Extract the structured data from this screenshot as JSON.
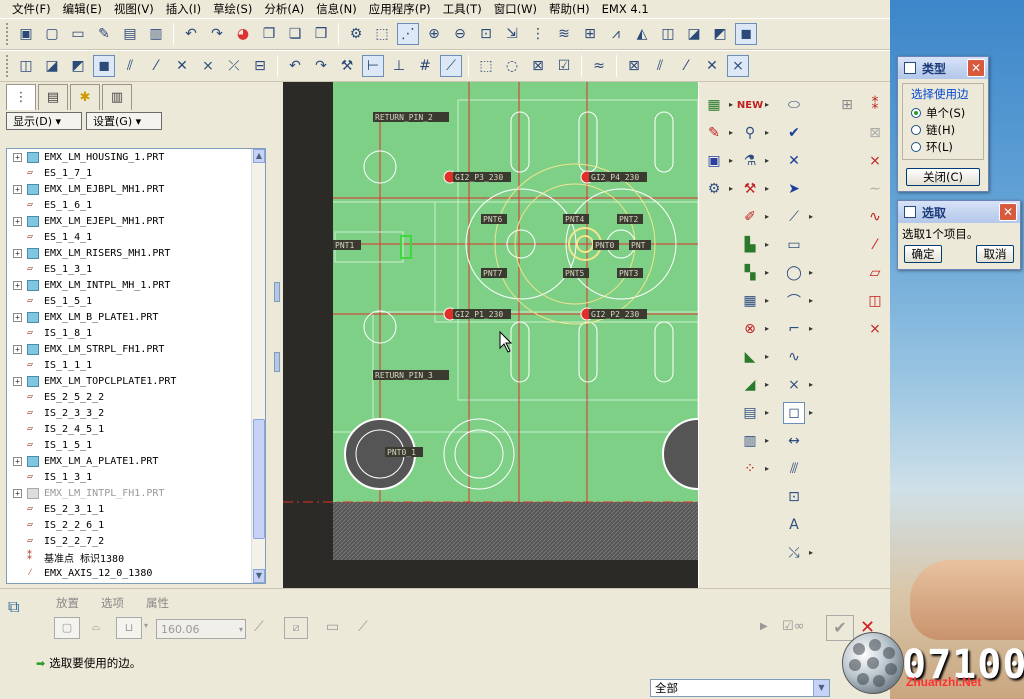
{
  "menu": [
    "文件(F)",
    "编辑(E)",
    "视图(V)",
    "插入(I)",
    "草绘(S)",
    "分析(A)",
    "信息(N)",
    "应用程序(P)",
    "工具(T)",
    "窗口(W)",
    "帮助(H)",
    "EMX 4.1"
  ],
  "panel": {
    "show_label": "显示(D) ▾",
    "settings_label": "设置(G) ▾"
  },
  "tree": [
    {
      "type": "part",
      "expand": true,
      "label": "EMX_LM_HOUSING_1.PRT"
    },
    {
      "type": "surf",
      "label": "ES_1_7_1"
    },
    {
      "type": "part",
      "expand": true,
      "label": "EMX_LM_EJBPL_MH1.PRT"
    },
    {
      "type": "surf",
      "label": "ES_1_6_1"
    },
    {
      "type": "part",
      "expand": true,
      "label": "EMX_LM_EJEPL_MH1.PRT"
    },
    {
      "type": "surf",
      "label": "ES_1_4_1"
    },
    {
      "type": "part",
      "expand": true,
      "label": "EMX_LM_RISERS_MH1.PRT"
    },
    {
      "type": "surf",
      "label": "ES_1_3_1"
    },
    {
      "type": "part",
      "expand": true,
      "label": "EMX_LM_INTPL_MH_1.PRT"
    },
    {
      "type": "surf",
      "label": "ES_1_5_1"
    },
    {
      "type": "part",
      "expand": true,
      "label": "EMX_LM_B_PLATE1.PRT"
    },
    {
      "type": "surf",
      "label": "IS_1_8_1"
    },
    {
      "type": "part",
      "expand": true,
      "label": "EMX_LM_STRPL_FH1.PRT"
    },
    {
      "type": "surf",
      "label": "IS_1_1_1"
    },
    {
      "type": "part",
      "expand": true,
      "label": "EMX_LM_TOPCLPLATE1.PRT"
    },
    {
      "type": "surf",
      "label": "ES_2_5_2_2"
    },
    {
      "type": "surf",
      "label": "IS_2_3_3_2"
    },
    {
      "type": "surf",
      "label": "IS_2_4_5_1"
    },
    {
      "type": "surf",
      "label": "IS_1_5_1"
    },
    {
      "type": "part",
      "expand": true,
      "label": "EMX_LM_A_PLATE1.PRT"
    },
    {
      "type": "surf",
      "label": "IS_1_3_1"
    },
    {
      "type": "part-grey",
      "expand": true,
      "label": "EMX_LM_INTPL_FH1.PRT"
    },
    {
      "type": "surf",
      "label": "ES_2_3_1_1"
    },
    {
      "type": "surf",
      "label": "IS_2_2_6_1"
    },
    {
      "type": "surf",
      "label": "IS_2_2_7_2"
    },
    {
      "type": "point",
      "label": "基准点 标识1380"
    },
    {
      "type": "axis",
      "label": "EMX_AXIS_12_0_1380"
    }
  ],
  "graphics": {
    "labels": [
      "RETURN_PIN_2",
      "GI2_P3_230",
      "GI2_P4_230",
      "PNT1",
      "PNT6",
      "PNT4",
      "PNT2",
      "PNT7",
      "PNT5",
      "PNT3",
      "PNT0",
      "GI2_P1_230",
      "GI2_P2_230",
      "RETURN_PIN_3",
      "PNT0_1"
    ],
    "pnt_label_right": "PNT"
  },
  "dashboard": {
    "tabs": [
      "放置",
      "选项",
      "属性"
    ],
    "value": "160.06",
    "status_message": "选取要使用的边。",
    "filter": "全部"
  },
  "type_dialog": {
    "title": "类型",
    "group_label": "选择使用边",
    "options": [
      "单个(S)",
      "链(H)",
      "环(L)"
    ],
    "selected": 0,
    "close_button": "关闭(C)"
  },
  "select_dialog": {
    "title": "选取",
    "message": "选取1个项目。",
    "ok": "确定",
    "cancel": "取消"
  },
  "watermark": {
    "number": "07100",
    "site": "Zhuanzhi.Net"
  },
  "colors": {
    "gfx_bg": "#2b2a27",
    "mold_green": "#7fd087",
    "construction_red": "#e0302a",
    "highlight_yellow": "#f0e68c"
  }
}
